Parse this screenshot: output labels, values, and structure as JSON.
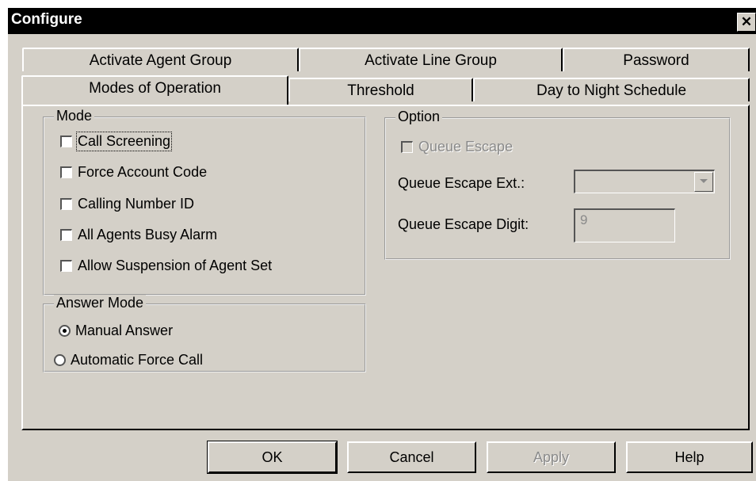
{
  "window": {
    "title": "Configure",
    "close_label": "✕"
  },
  "tabs_back": [
    {
      "label": "Activate Agent Group"
    },
    {
      "label": "Activate Line Group"
    },
    {
      "label": "Password"
    }
  ],
  "tabs_front": [
    {
      "label": "Modes of Operation",
      "active": true
    },
    {
      "label": "Threshold"
    },
    {
      "label": "Day to Night Schedule"
    }
  ],
  "mode": {
    "legend": "Mode",
    "items": [
      {
        "label": "Call Screening",
        "checked": false,
        "focused": true
      },
      {
        "label": "Force Account Code",
        "checked": false
      },
      {
        "label": "Calling Number ID",
        "checked": false
      },
      {
        "label": "All Agents Busy Alarm",
        "checked": false
      },
      {
        "label": "Allow Suspension of Agent Set",
        "checked": false
      }
    ]
  },
  "answer_mode": {
    "legend": "Answer Mode",
    "options": [
      {
        "label": "Manual Answer",
        "selected": true
      },
      {
        "label": "Automatic Force Call",
        "selected": false
      }
    ]
  },
  "option": {
    "legend": "Option",
    "queue_escape_label": "Queue Escape",
    "queue_escape_checked": false,
    "queue_escape_ext_label": "Queue Escape Ext.:",
    "queue_escape_ext_value": "",
    "queue_escape_digit_label": "Queue Escape Digit:",
    "queue_escape_digit_value": "9"
  },
  "buttons": {
    "ok": "OK",
    "cancel": "Cancel",
    "apply": "Apply",
    "help": "Help"
  }
}
